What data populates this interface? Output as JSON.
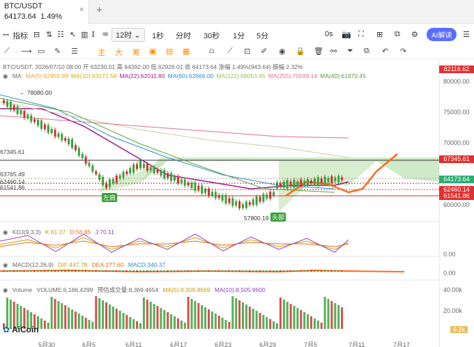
{
  "tab": {
    "symbol": "BTC/USDT",
    "price": "64173.64",
    "change": "1.49%",
    "close": "×",
    "plus": "+"
  },
  "toolbar1": {
    "indicator": "指标",
    "timeframe": "12时",
    "items": [
      "1秒",
      "分时",
      "30秒",
      "1分",
      "5分"
    ],
    "zero_s": "0s",
    "ai": "AI解读"
  },
  "toolbar2": {
    "tools": [
      "主",
      "大",
      "筹"
    ]
  },
  "ohlc": "BTC/USDT, 2026/07/10 08:00  开 63230.01  高 64392.00  低 62926.01  收 64173.64  涨幅 1.49%(943.64)  振幅 2.32%",
  "ma": {
    "label": "MA",
    "items": [
      {
        "text": "MA(5):62955.99",
        "color": "#f0a020"
      },
      {
        "text": "MA(10):63172.58",
        "color": "#c8b400"
      },
      {
        "text": "MA(22):62011.80",
        "color": "#9b1c8c"
      },
      {
        "text": "MA(60):62666.00",
        "color": "#2a8fd0"
      },
      {
        "text": "MA(122):68053.45",
        "color": "#9cc060"
      },
      {
        "text": "MA(255):70599.14",
        "color": "#e07090"
      },
      {
        "text": "MA(40):61870.45",
        "color": "#60a040"
      }
    ]
  },
  "price_axis": [
    "80000.00",
    "75000.00",
    "70000.00",
    "60000.00"
  ],
  "price_tags": [
    {
      "text": "82116.62",
      "color": "#e03030"
    },
    {
      "text": "67345.61",
      "color": "#e03030"
    },
    {
      "text": "64173.64",
      "color": "#2bae72"
    },
    {
      "text": "62460.14",
      "color": "#e03030"
    },
    {
      "text": "61541.86",
      "color": "#e03030"
    }
  ],
  "left_levels": [
    "67345.61",
    "63765.49",
    "62460.14",
    "61541.86"
  ],
  "annotations": {
    "high": "← 78080.00",
    "low": "57800.19",
    "left_shoulder": "左肩",
    "head": "头部"
  },
  "kdj": {
    "label": "KDJ(9,3,3)",
    "k": "K:61.27",
    "d": "D:56.85",
    "j": "J:70.11",
    "axis0": "0.00"
  },
  "macd": {
    "label": "MACD(12,26,9)",
    "dif": "DIF:447.78",
    "dea": "DEA:277.60",
    "macd": "MACD:340.37",
    "axis0": "0.00"
  },
  "volume": {
    "label": "Volume",
    "vol": "VOLUME:6,186.4299",
    "est": "预估成交量:8,369.4654",
    "ma5": "MA(5):8,309.8669",
    "ma10": "MA(10):8,505.9600",
    "axis_top": "40.00k",
    "axis_mid": "20.00k",
    "current": "6.2k"
  },
  "logo": "AiCoin",
  "dates": [
    "5月30",
    "6月5",
    "6月11",
    "6月17",
    "6月23",
    "6月29",
    "7月5",
    "7月11",
    "7月17"
  ]
}
